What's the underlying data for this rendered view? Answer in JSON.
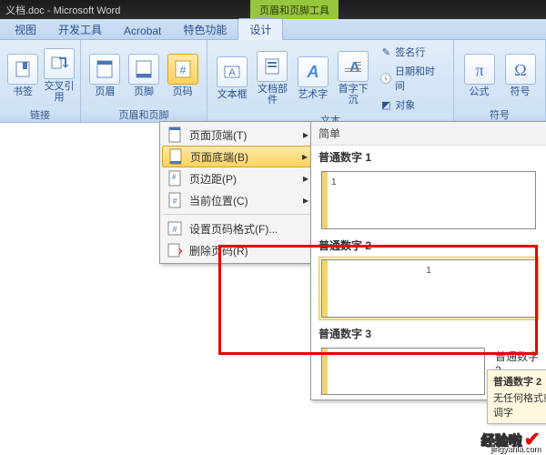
{
  "window": {
    "title": "义档.doc - Microsoft Word",
    "contextTab": "页眉和页脚工具"
  },
  "tabs": [
    "视图",
    "开发工具",
    "Acrobat",
    "特色功能",
    "设计"
  ],
  "ribbon": {
    "groups": {
      "links": {
        "label": "链接",
        "items": [
          "书签",
          "交叉引用"
        ]
      },
      "headerFooter": {
        "label": "页眉和页脚",
        "items": [
          "页眉",
          "页脚",
          "页码"
        ]
      },
      "text": {
        "label": "文本",
        "items": [
          "文本框",
          "文档部件",
          "艺术字",
          "首字下沉"
        ],
        "small": [
          "签名行",
          "日期和时间",
          "对象"
        ]
      },
      "symbols": {
        "label": "符号",
        "items": [
          "公式",
          "符号"
        ]
      }
    }
  },
  "menu": {
    "items": [
      {
        "label": "页面顶端(T)",
        "arrow": true
      },
      {
        "label": "页面底端(B)",
        "arrow": true,
        "hi": true
      },
      {
        "label": "页边距(P)",
        "arrow": true
      },
      {
        "label": "当前位置(C)",
        "arrow": true
      },
      {
        "label": "设置页码格式(F)...",
        "arrow": false,
        "sepBefore": true
      },
      {
        "label": "删除页码(R)",
        "arrow": false
      }
    ]
  },
  "gallery": {
    "head": "简单",
    "sections": [
      {
        "title": "普通数字 1",
        "hi": false,
        "align": "left"
      },
      {
        "title": "普通数字 2",
        "hi": true,
        "align": "center"
      },
      {
        "title": "普通数字 3",
        "hi": false,
        "align": "center",
        "partial": true
      }
    ],
    "extraLabel": "普通数字 2"
  },
  "tooltip": {
    "title": "普通数字 2",
    "body": "无任何格式或强调字"
  },
  "logo": {
    "text": "经验啦",
    "url": "jingyanla.com"
  }
}
